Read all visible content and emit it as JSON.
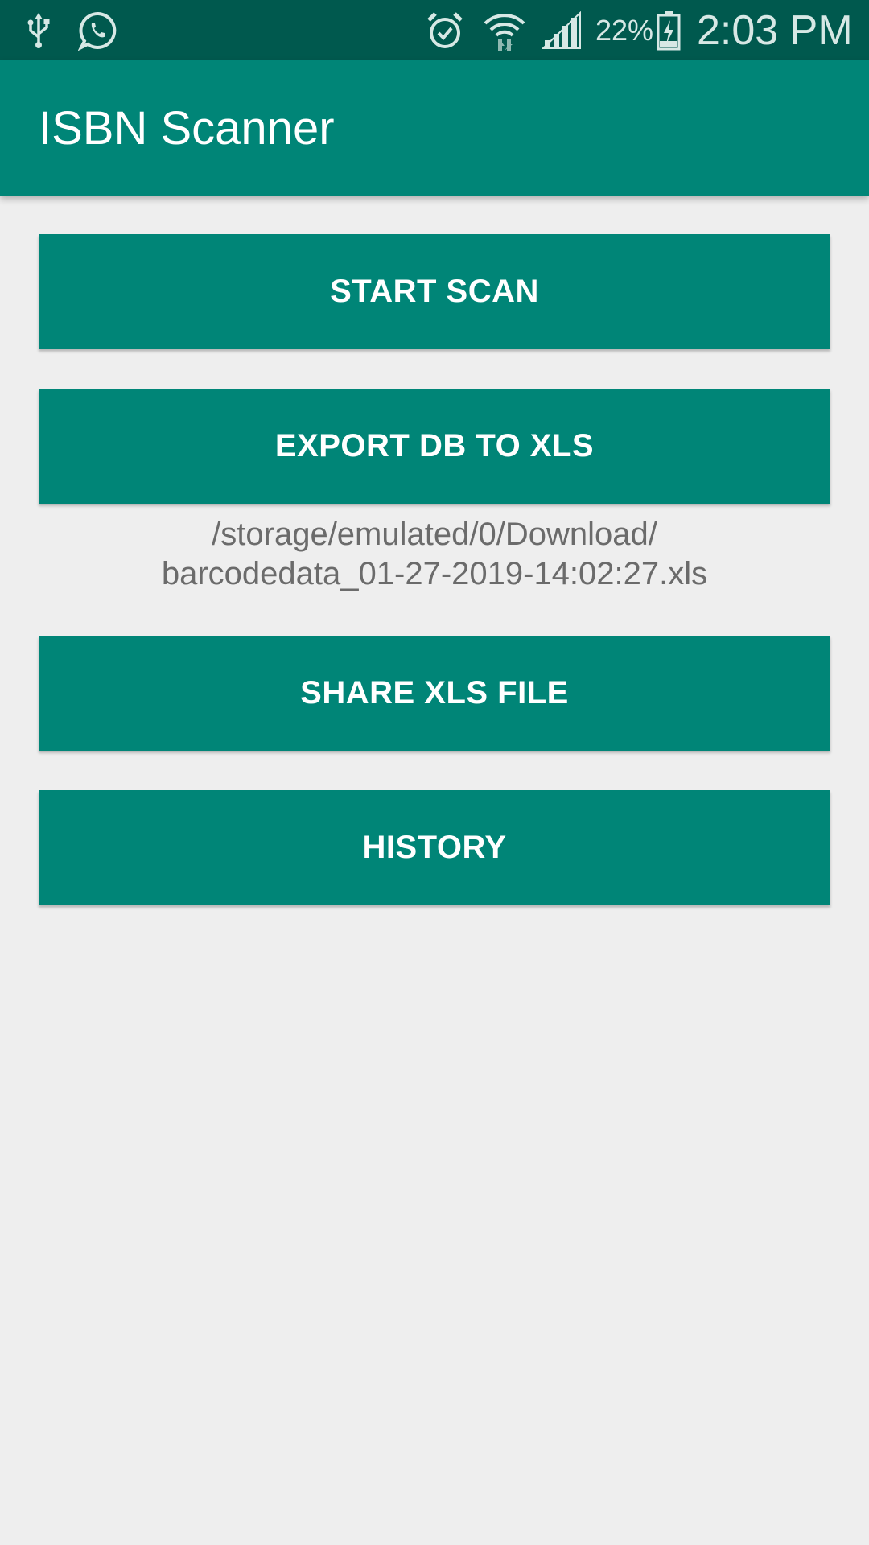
{
  "status_bar": {
    "battery_percent": "22%",
    "time": "2:03 PM",
    "icons": [
      "usb-icon",
      "whatsapp-icon",
      "alarm-icon",
      "wifi-icon",
      "signal-icon",
      "battery-charging-icon"
    ]
  },
  "app_bar": {
    "title": "ISBN Scanner"
  },
  "buttons": {
    "start_scan": "START SCAN",
    "export_db": "EXPORT DB TO XLS",
    "share_xls": "SHARE XLS FILE",
    "history": "HISTORY"
  },
  "export_path": {
    "line1": "/storage/emulated/0/Download/",
    "line2": "barcodedata_01-27-2019-14:02:27.xls"
  },
  "colors": {
    "primary": "#008577",
    "primary_dark": "#00594e",
    "background": "#eeeeee",
    "button_text": "#ffffff",
    "path_text": "#6b6b6b"
  }
}
